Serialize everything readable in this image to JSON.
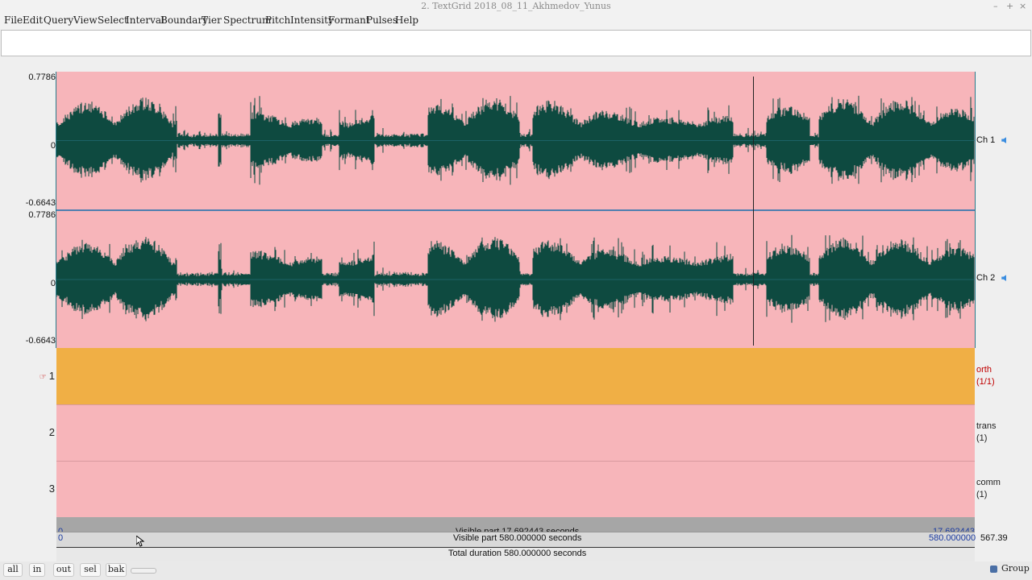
{
  "window": {
    "title": "2. TextGrid 2018_08_11_Akhmedov_Yunus",
    "controls": [
      "–",
      "+",
      "×"
    ]
  },
  "menu": [
    "File",
    "Edit",
    "Query",
    "View",
    "Select",
    "Interval",
    "Boundary",
    "Tier",
    "Spectrum",
    "Pitch",
    "Intensity",
    "Formant",
    "Pulses",
    "Help"
  ],
  "text_field": {
    "value": ""
  },
  "channels": [
    {
      "label": "Ch 1",
      "ymax": "0.7786",
      "yzero": "0",
      "ymin": "-0.6643"
    },
    {
      "label": "Ch 2",
      "ymax": "0.7786",
      "yzero": "0",
      "ymin": "-0.6643"
    }
  ],
  "tiers": [
    {
      "number": "1",
      "name": "orth",
      "count": "(1/1)",
      "selected": true,
      "pointer_icon": "☞"
    },
    {
      "number": "2",
      "name": "trans",
      "count": "(1)",
      "selected": false
    },
    {
      "number": "3",
      "name": "comm",
      "count": "(1)",
      "selected": false
    }
  ],
  "time_bars": {
    "visible_part": "Visible part 17.692443 seconds",
    "visible_start": "0",
    "visible_end": "17.692443",
    "window_start": "0",
    "window_text": "Visible part 580.000000 seconds",
    "window_end": "580.000000",
    "window_right": "567.39",
    "total": "Total duration 580.000000 seconds"
  },
  "buttons": {
    "all": "all",
    "in": "in",
    "out": "out",
    "sel": "sel",
    "bak": "bak",
    "group": "Group"
  },
  "colors": {
    "plot_bg": "#f7b5ba",
    "wave": "#0e4a40",
    "tier_selected": "#f0af45",
    "cursor": "#222222"
  }
}
